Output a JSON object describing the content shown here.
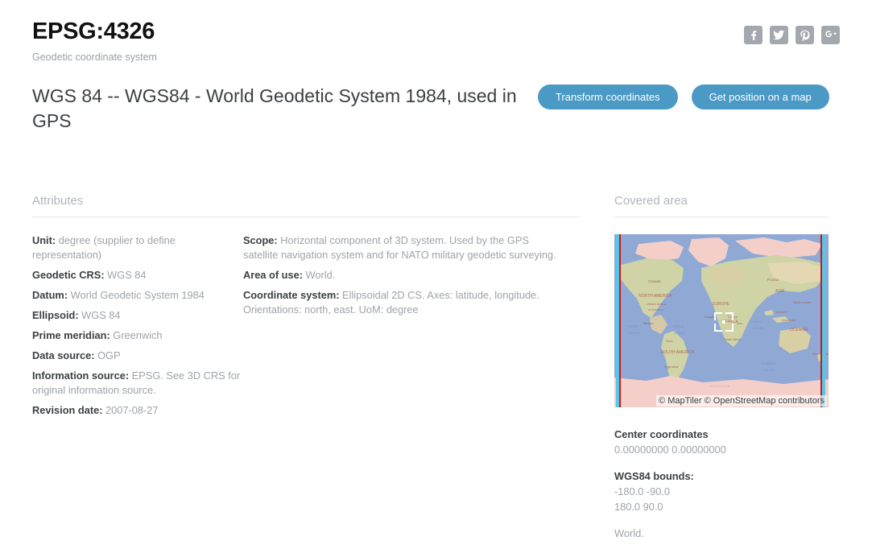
{
  "header": {
    "code": "EPSG:4326",
    "subtitle": "Geodetic coordinate system",
    "social": [
      {
        "name": "facebook-icon",
        "label": "Facebook"
      },
      {
        "name": "twitter-icon",
        "label": "Twitter"
      },
      {
        "name": "pinterest-icon",
        "label": "Pinterest"
      },
      {
        "name": "googleplus-icon",
        "label": "Google Plus"
      }
    ]
  },
  "title": {
    "text": "WGS 84 -- WGS84 - World Geodetic System 1984, used in GPS"
  },
  "actions": {
    "transform_label": "Transform coordinates",
    "position_label": "Get position on a map",
    "accent_color": "#4a9ac5"
  },
  "attributes": {
    "heading": "Attributes",
    "left": [
      {
        "key": "Unit:",
        "value": "degree (supplier to define representation)"
      },
      {
        "key": "Geodetic CRS:",
        "value": "WGS 84"
      },
      {
        "key": "Datum:",
        "value": "World Geodetic System 1984"
      },
      {
        "key": "Ellipsoid:",
        "value": "WGS 84"
      },
      {
        "key": "Prime meridian:",
        "value": "Greenwich"
      },
      {
        "key": "Data source:",
        "value": "OGP"
      },
      {
        "key": "Information source:",
        "value": "EPSG. See 3D CRS for original information source."
      },
      {
        "key": "Revision date:",
        "value": "2007-08-27"
      }
    ],
    "right": [
      {
        "key": "Scope:",
        "value": "Horizontal component of 3D system. Used by the GPS satellite navigation system and for NATO military geodetic surveying."
      },
      {
        "key": "Area of use:",
        "value": "World."
      },
      {
        "key": "Coordinate system:",
        "value": "Ellipsoidal 2D CS. Axes: latitude, longitude. Orientations: north, east. UoM: degree"
      }
    ]
  },
  "covered_area": {
    "heading": "Covered area",
    "map": {
      "attribution": "© MapTiler © OpenStreetMap contributors",
      "bounds_line_color": "#d61414",
      "ocean_color": "#8fa9d4",
      "labels": [
        "Canada",
        "NORTH AMERICA",
        "United States of America",
        "Mexico",
        "Atlantic Ocean",
        "Pacific Ocean",
        "Peru",
        "SOUTH AMERICA",
        "Argentina",
        "EUROPE",
        "España",
        "Türkiye",
        "Iran",
        "AFRICA",
        "South Africa",
        "Russia",
        "ASIA",
        "South Korea",
        "Vietnam",
        "Indonesia",
        "OCEANIA",
        "New Zealand",
        "Indian Ocean",
        "Southern Ocean",
        "ANTARCTICA"
      ]
    },
    "center_label": "Center coordinates",
    "center_value": "0.00000000 0.00000000",
    "bounds_label": "WGS84 bounds:",
    "bounds_min": "-180.0 -90.0",
    "bounds_max": "180.0 90.0",
    "area_note": "World."
  }
}
